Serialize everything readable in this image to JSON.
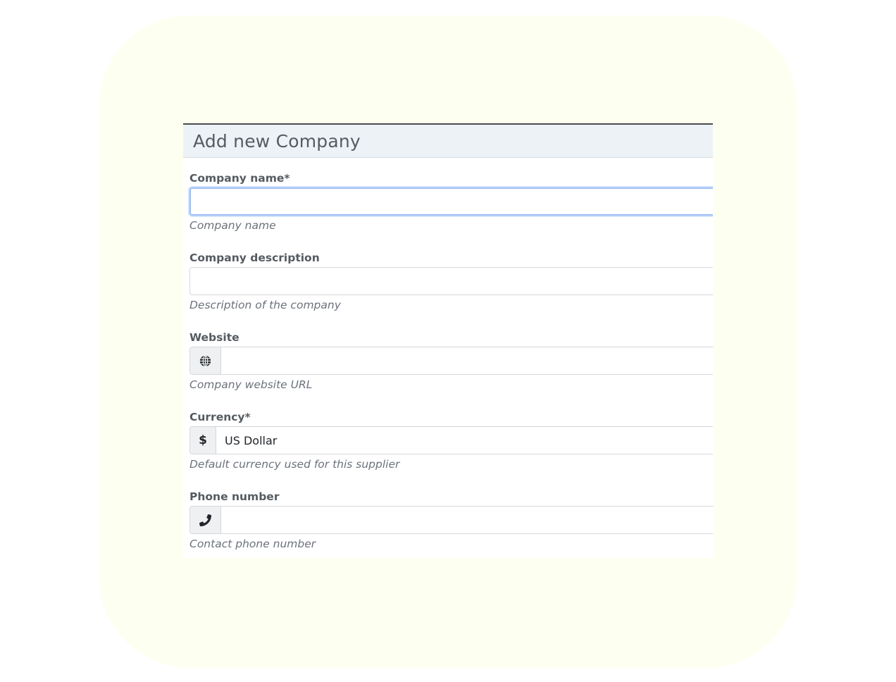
{
  "modal": {
    "title": "Add new Company"
  },
  "fields": {
    "company_name": {
      "label": "Company name*",
      "value": "",
      "help": "Company name"
    },
    "description": {
      "label": "Company description",
      "value": "",
      "help": "Description of the company"
    },
    "website": {
      "label": "Website",
      "icon": "globe-icon",
      "value": "",
      "help": "Company website URL"
    },
    "currency": {
      "label": "Currency*",
      "icon": "dollar-icon",
      "icon_text": "$",
      "value": "US Dollar",
      "help": "Default currency used for this supplier"
    },
    "phone": {
      "label": "Phone number",
      "icon": "phone-icon",
      "value": "",
      "help": "Contact phone number"
    }
  },
  "colors": {
    "backdrop": "#fdfff1",
    "header_bg": "#edf2f6",
    "focus_border": "#9dbdf2"
  }
}
